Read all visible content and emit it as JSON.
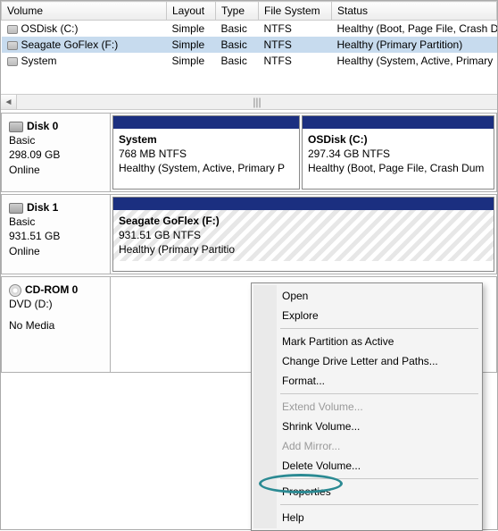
{
  "cols": {
    "volume": "Volume",
    "layout": "Layout",
    "type": "Type",
    "fs": "File System",
    "status": "Status"
  },
  "vols": {
    "r0": {
      "n": "OSDisk (C:)",
      "l": "Simple",
      "t": "Basic",
      "f": "NTFS",
      "s": "Healthy (Boot, Page File, Crash D"
    },
    "r1": {
      "n": "Seagate GoFlex (F:)",
      "l": "Simple",
      "t": "Basic",
      "f": "NTFS",
      "s": "Healthy (Primary Partition)"
    },
    "r2": {
      "n": "System",
      "l": "Simple",
      "t": "Basic",
      "f": "NTFS",
      "s": "Healthy (System, Active, Primary"
    }
  },
  "scroll_handle": "|||",
  "disk0": {
    "title": "Disk 0",
    "type": "Basic",
    "size": "298.09 GB",
    "state": "Online",
    "p0": {
      "name": "System",
      "sub": "768 MB NTFS",
      "stat": "Healthy (System, Active, Primary P"
    },
    "p1": {
      "name": "OSDisk  (C:)",
      "sub": "297.34 GB NTFS",
      "stat": "Healthy (Boot, Page File, Crash Dum"
    }
  },
  "disk1": {
    "title": "Disk 1",
    "type": "Basic",
    "size": "931.51 GB",
    "state": "Online",
    "p0": {
      "name": "Seagate GoFlex  (F:)",
      "sub": "931.51 GB NTFS",
      "stat": "Healthy (Primary Partitio"
    }
  },
  "cd": {
    "title": "CD-ROM 0",
    "sub": "DVD (D:)",
    "state": "No Media"
  },
  "menu": {
    "open": "Open",
    "explore": "Explore",
    "mark": "Mark Partition as Active",
    "change": "Change Drive Letter and Paths...",
    "format": "Format...",
    "extend": "Extend Volume...",
    "shrink": "Shrink Volume...",
    "mirror": "Add Mirror...",
    "delete": "Delete Volume...",
    "props": "Properties",
    "help": "Help"
  }
}
